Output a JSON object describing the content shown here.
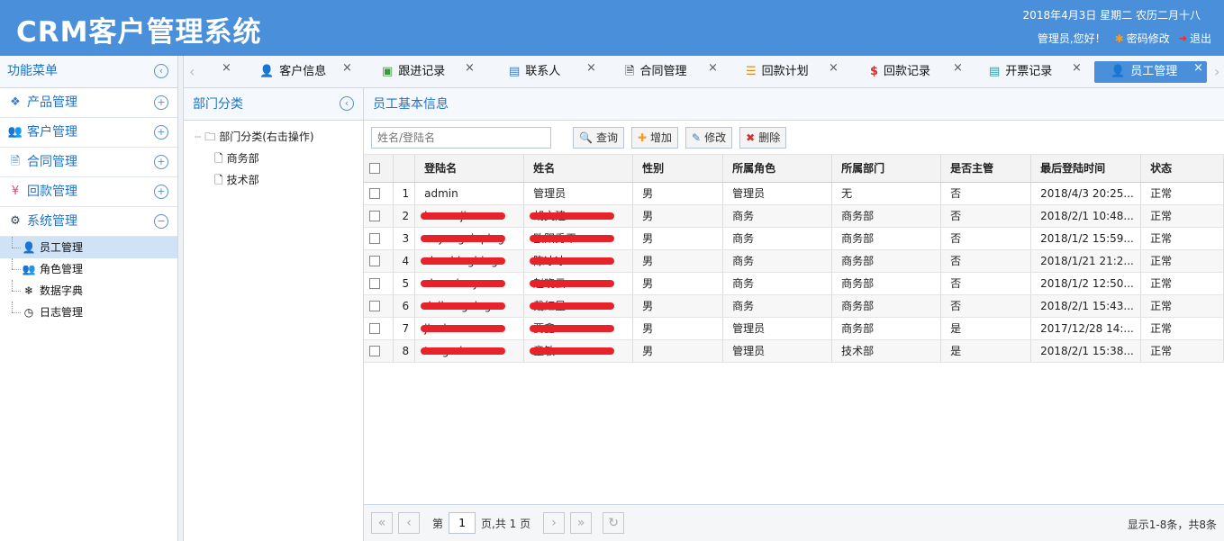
{
  "header": {
    "title": "CRM客户管理系统",
    "date": "2018年4月3日 星期二 农历二月十八",
    "greeting": "管理员,您好！",
    "pwd_link": "密码修改",
    "logout": "退出"
  },
  "sidebar": {
    "title": "功能菜单",
    "collapse_icon": "chevron-left-circle-icon",
    "items": [
      {
        "label": "产品管理",
        "icon": "cubes-icon",
        "state": "collapsed"
      },
      {
        "label": "客户管理",
        "icon": "users-icon",
        "state": "collapsed"
      },
      {
        "label": "合同管理",
        "icon": "document-icon",
        "state": "collapsed"
      },
      {
        "label": "回款管理",
        "icon": "yen-icon",
        "state": "collapsed"
      },
      {
        "label": "系统管理",
        "icon": "gear-icon",
        "state": "expanded"
      }
    ],
    "subitems": [
      {
        "label": "员工管理",
        "icon": "user-icon"
      },
      {
        "label": "角色管理",
        "icon": "users-icon"
      },
      {
        "label": "数据字典",
        "icon": "snowflake-icon"
      },
      {
        "label": "日志管理",
        "icon": "clock-icon"
      }
    ]
  },
  "tabs": [
    {
      "label": "客户信息",
      "icon": "user-icon"
    },
    {
      "label": "跟进记录",
      "icon": "contact-icon"
    },
    {
      "label": "联系人",
      "icon": "card-icon"
    },
    {
      "label": "合同管理",
      "icon": "document-icon"
    },
    {
      "label": "回款计划",
      "icon": "list-icon"
    },
    {
      "label": "回款记录",
      "icon": "dollar-icon"
    },
    {
      "label": "开票记录",
      "icon": "invoice-icon"
    },
    {
      "label": "员工管理",
      "icon": "user-icon"
    }
  ],
  "dept": {
    "title": "部门分类",
    "root": "部门分类(右击操作)",
    "children": [
      "商务部",
      "技术部"
    ]
  },
  "main": {
    "title": "员工基本信息",
    "search_placeholder": "姓名/登陆名",
    "buttons": {
      "query": "查询",
      "add": "增加",
      "edit": "修改",
      "delete": "删除"
    },
    "columns": [
      "登陆名",
      "姓名",
      "性别",
      "所属角色",
      "所属部门",
      "是否主管",
      "最后登陆时间",
      "状态"
    ],
    "rows": [
      {
        "n": "1",
        "login": "admin",
        "name": "管理员",
        "sex": "男",
        "role": "管理员",
        "dept": "无",
        "mgr": "否",
        "time": "2018/4/3 20:25...",
        "status": "正常"
      },
      {
        "n": "2",
        "login": "huwenjian",
        "name": "胡文建",
        "sex": "男",
        "role": "商务",
        "dept": "商务部",
        "mgr": "否",
        "time": "2018/2/1 10:48...",
        "status": "正常"
      },
      {
        "n": "3",
        "login": "ouyangxiuping",
        "name": "欧阳秀平",
        "sex": "男",
        "role": "商务",
        "dept": "商务部",
        "mgr": "否",
        "time": "2018/1/2 15:59...",
        "status": "正常"
      },
      {
        "n": "4",
        "login": "chenbingbing",
        "name": "陈冰冰",
        "sex": "男",
        "role": "商务",
        "dept": "商务部",
        "mgr": "否",
        "time": "2018/1/21 21:2...",
        "status": "正常"
      },
      {
        "n": "5",
        "login": "zhaoxiaoyun",
        "name": "赵晓云",
        "sex": "男",
        "role": "商务",
        "dept": "商务部",
        "mgr": "否",
        "time": "2018/1/2 12:50...",
        "status": "正常"
      },
      {
        "n": "6",
        "login": "daihongxing",
        "name": "戴红星",
        "sex": "男",
        "role": "商务",
        "dept": "商务部",
        "mgr": "否",
        "time": "2018/2/1 15:43...",
        "status": "正常"
      },
      {
        "n": "7",
        "login": "jiaxin",
        "name": "贾鑫",
        "sex": "男",
        "role": "管理员",
        "dept": "商务部",
        "mgr": "是",
        "time": "2017/12/28 14:...",
        "status": "正常"
      },
      {
        "n": "8",
        "login": "tongmin",
        "name": "童敏",
        "sex": "男",
        "role": "管理员",
        "dept": "技术部",
        "mgr": "是",
        "time": "2018/2/1 15:38...",
        "status": "正常"
      }
    ],
    "redacted_rows": [
      "2",
      "3",
      "4",
      "5",
      "6",
      "7",
      "8"
    ]
  },
  "pager": {
    "page_prefix": "第",
    "page": "1",
    "page_suffix": "页,共 1 页",
    "info": "显示1-8条，共8条"
  }
}
